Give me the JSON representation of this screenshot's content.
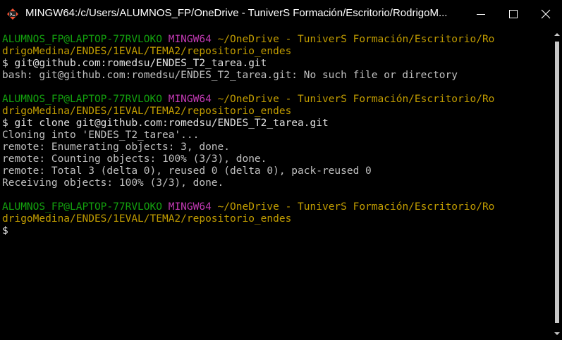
{
  "window": {
    "title": "MINGW64:/c/Users/ALUMNOS_FP/OneDrive - TuniverS Formación/Escritorio/RodrigoM...",
    "icons": {
      "app": "git-bash-icon",
      "minimize": "minimize-icon",
      "maximize": "maximize-icon",
      "close": "close-icon"
    }
  },
  "terminal": {
    "blocks": [
      {
        "prompt": {
          "user": "ALUMNOS_FP@LAPTOP-77RVLOKO",
          "shell": "MINGW64",
          "path_line1": "~/OneDrive - TuniverS Formación/Escritorio/Ro",
          "path_line2": "drigoMedina/ENDES/1EVAL/TEMA2/repositorio_endes"
        },
        "command": "$ git@github.com:romedsu/ENDES_T2_tarea.git",
        "output": [
          "bash: git@github.com:romedsu/ENDES_T2_tarea.git: No such file or directory"
        ]
      },
      {
        "prompt": {
          "user": "ALUMNOS_FP@LAPTOP-77RVLOKO",
          "shell": "MINGW64",
          "path_line1": "~/OneDrive - TuniverS Formación/Escritorio/Ro",
          "path_line2": "drigoMedina/ENDES/1EVAL/TEMA2/repositorio_endes"
        },
        "command": "$ git clone git@github.com:romedsu/ENDES_T2_tarea.git",
        "output": [
          "Cloning into 'ENDES_T2_tarea'...",
          "remote: Enumerating objects: 3, done.",
          "remote: Counting objects: 100% (3/3), done.",
          "remote: Total 3 (delta 0), reused 0 (delta 0), pack-reused 0",
          "Receiving objects: 100% (3/3), done."
        ]
      },
      {
        "prompt": {
          "user": "ALUMNOS_FP@LAPTOP-77RVLOKO",
          "shell": "MINGW64",
          "path_line1": "~/OneDrive - TuniverS Formación/Escritorio/Ro",
          "path_line2": "drigoMedina/ENDES/1EVAL/TEMA2/repositorio_endes"
        },
        "command": "$",
        "output": []
      }
    ]
  },
  "colors": {
    "user": "#13a10e",
    "shell": "#c239b3",
    "path": "#c19c00",
    "text": "#c0c0c0",
    "background": "#000000"
  }
}
